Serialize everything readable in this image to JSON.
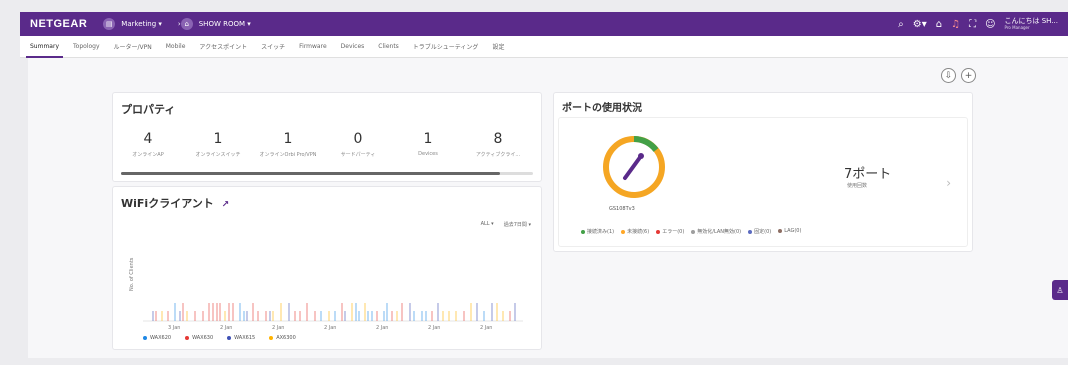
{
  "header": {
    "logo": "NETGEAR",
    "logo_sub": "",
    "location": "Marketing",
    "network": "SHOW ROOM",
    "user_name": "こんにちは SH...",
    "user_role": "Pro Manager"
  },
  "tabs": [
    {
      "label": "Summary",
      "active": true
    },
    {
      "label": "Topology"
    },
    {
      "label": "ルーター/VPN"
    },
    {
      "label": "Mobile"
    },
    {
      "label": "アクセスポイント"
    },
    {
      "label": "スイッチ"
    },
    {
      "label": "Firmware"
    },
    {
      "label": "Devices"
    },
    {
      "label": "Clients"
    },
    {
      "label": "トラブルシューティング"
    },
    {
      "label": "設定"
    }
  ],
  "properties": {
    "title": "プロパティ",
    "stats": [
      {
        "value": "4",
        "label": "オンラインAP"
      },
      {
        "value": "1",
        "label": "オンラインスイッチ"
      },
      {
        "value": "1",
        "label": "オンラインOrbi Pro/VPN"
      },
      {
        "value": "0",
        "label": "サードパーティ"
      },
      {
        "value": "1",
        "label": "Devices"
      },
      {
        "value": "8",
        "label": "アクティブクライ..."
      }
    ]
  },
  "wifi": {
    "title": "WiFiクライアント",
    "filter1": "ALL",
    "filter2": "過去7日間",
    "xticks": [
      "3 Jan",
      "2 Jan",
      "2 Jan",
      "2 Jan",
      "2 Jan",
      "2 Jan",
      "2 Jan"
    ],
    "ylabel": "No. of Clients",
    "legend": [
      {
        "name": "WAX620",
        "color": "#1e88e5"
      },
      {
        "name": "WAX630",
        "color": "#e53935"
      },
      {
        "name": "WAX615",
        "color": "#3f51b5"
      },
      {
        "name": "AX6300",
        "color": "#ffb300"
      }
    ]
  },
  "ports": {
    "title": "ポートの使用状況",
    "device": "GS108Tv3",
    "count": "7ポート",
    "count_sub": "使用回数",
    "legend": [
      {
        "label": "接続済み(1)",
        "color": "#43a047"
      },
      {
        "label": "未接続(6)",
        "color": "#ffa726"
      },
      {
        "label": "エラー(0)",
        "color": "#e53935"
      },
      {
        "label": "無効化/LAN無効(0)",
        "color": "#9e9e9e"
      },
      {
        "label": "固定(0)",
        "color": "#5c6bc0"
      },
      {
        "label": "LAG(0)",
        "color": "#8d6e63"
      }
    ]
  },
  "colors": {
    "brand": "#5a2a8a",
    "accent_green": "#43a047",
    "accent_orange": "#f5a623"
  }
}
